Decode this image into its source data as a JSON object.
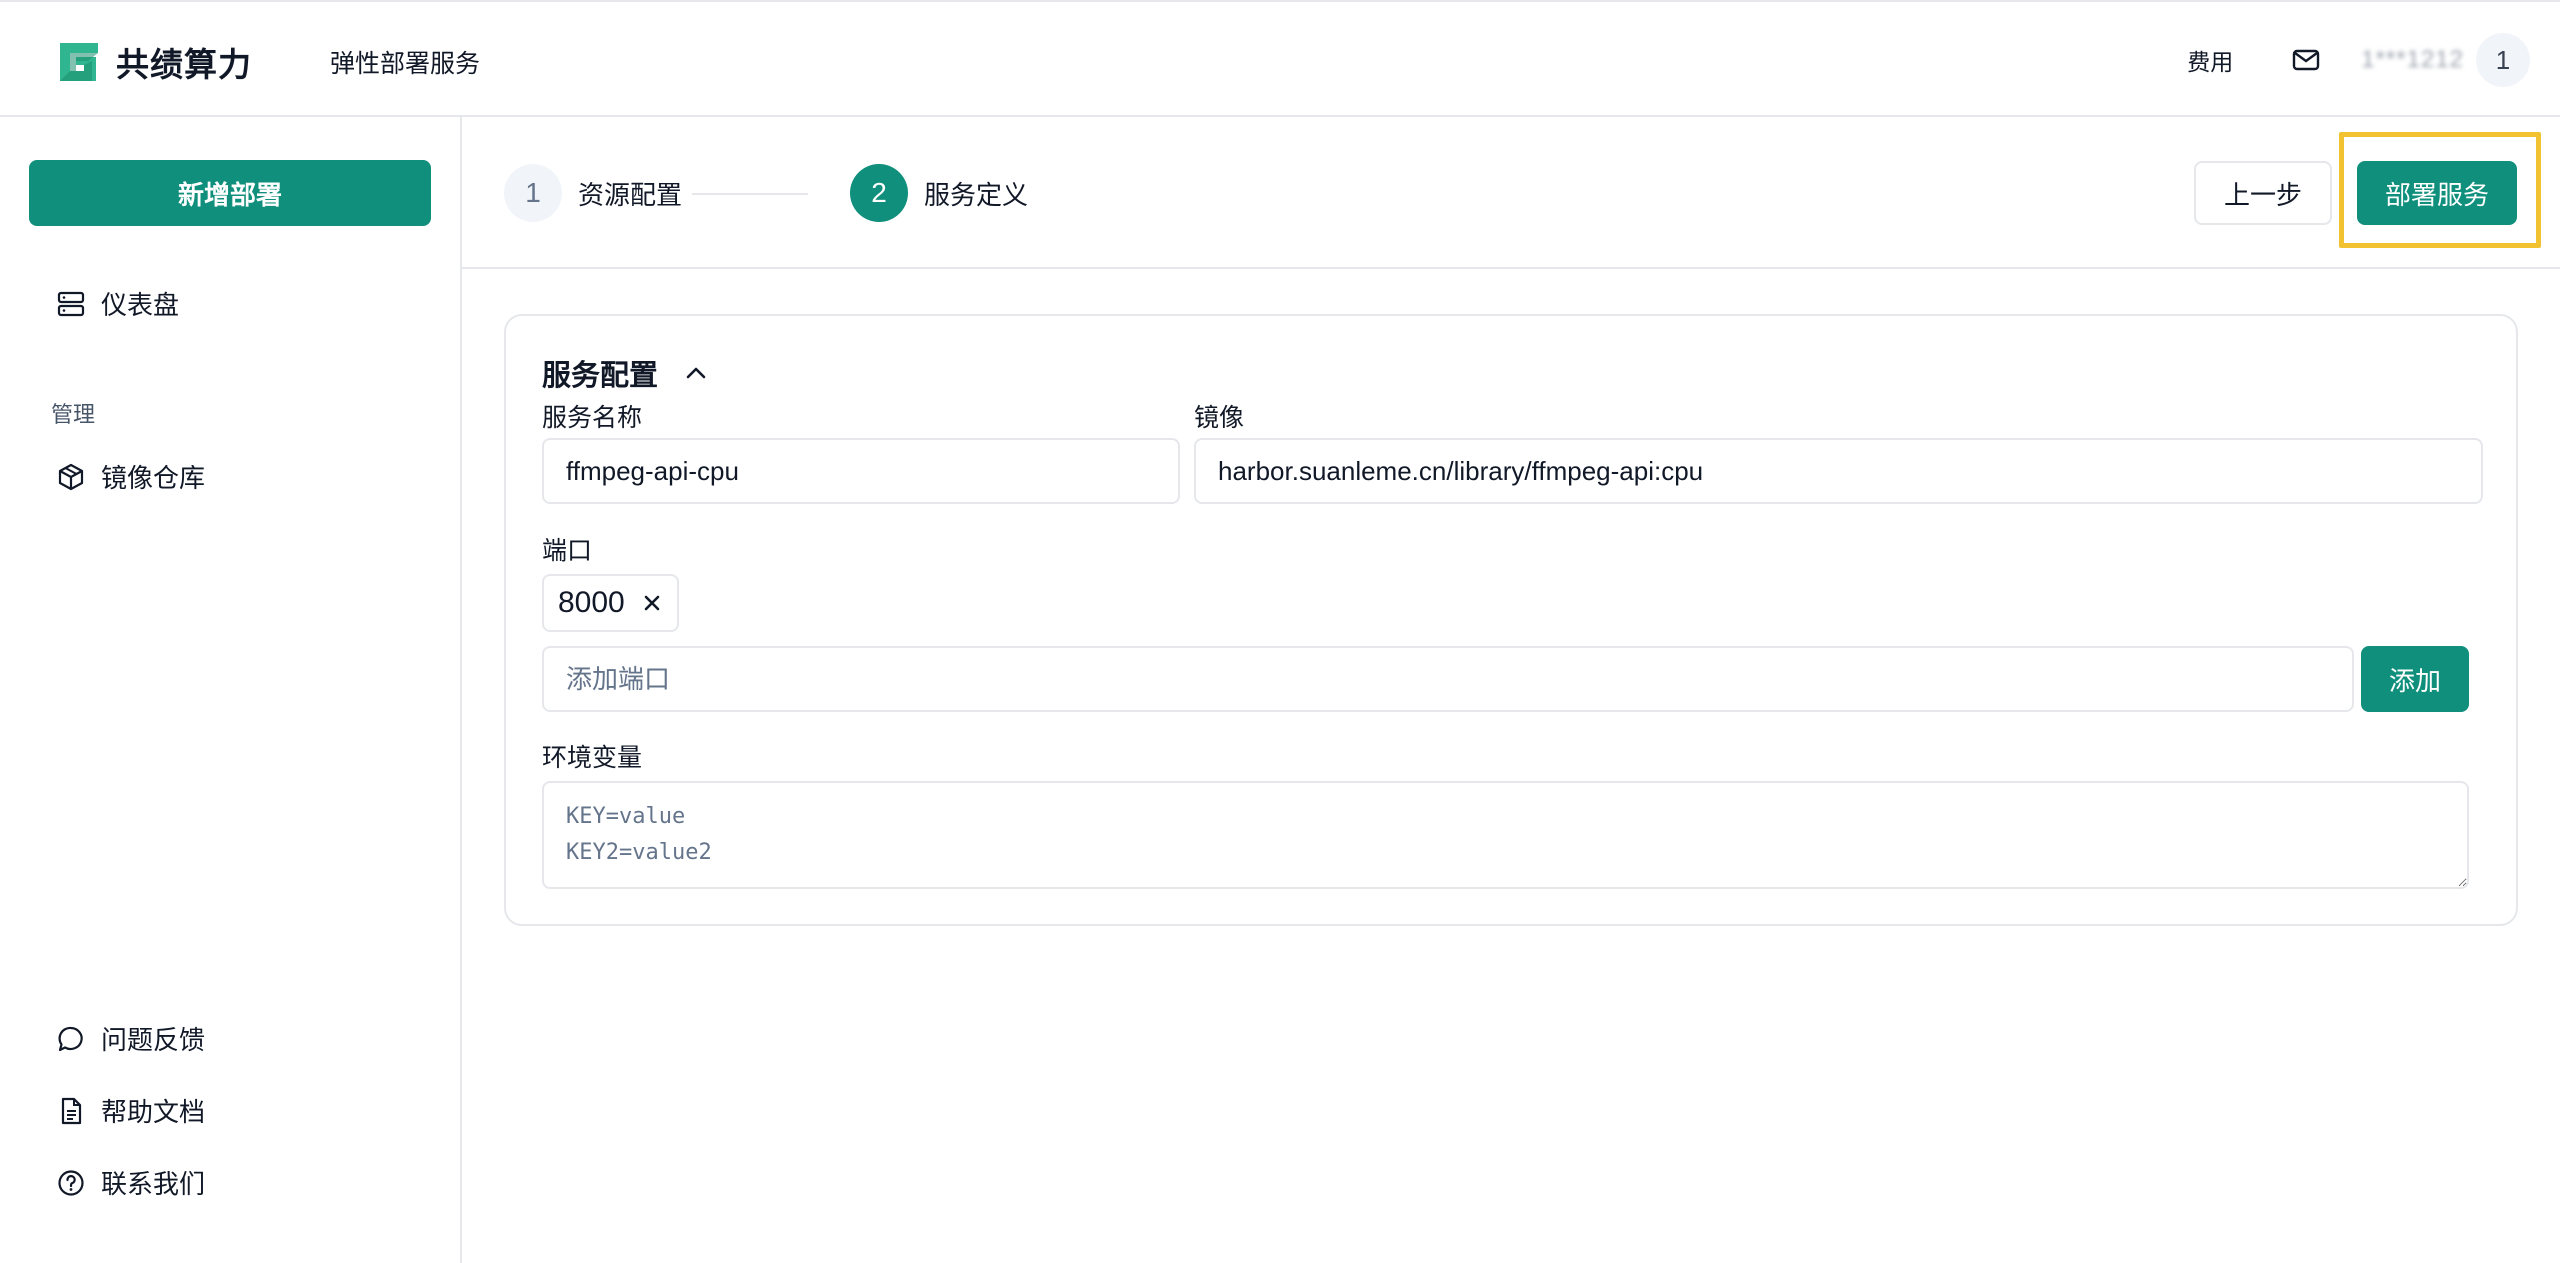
{
  "header": {
    "brand": "共绩算力",
    "product": "弹性部署服务",
    "fee_link": "费用",
    "user_id": "1***1212",
    "avatar_initial": "1"
  },
  "sidebar": {
    "new_deploy": "新增部署",
    "dashboard": "仪表盘",
    "section_manage": "管理",
    "image_repo": "镜像仓库",
    "feedback": "问题反馈",
    "help_docs": "帮助文档",
    "contact": "联系我们"
  },
  "steps": [
    {
      "number": "1",
      "label": "资源配置"
    },
    {
      "number": "2",
      "label": "服务定义"
    }
  ],
  "actions": {
    "prev": "上一步",
    "deploy": "部署服务"
  },
  "service_config": {
    "title": "服务配置",
    "name_label": "服务名称",
    "name_value": "ffmpeg-api-cpu",
    "image_label": "镜像",
    "image_value": "harbor.suanleme.cn/library/ffmpeg-api:cpu",
    "port_label": "端口",
    "ports": [
      "8000"
    ],
    "port_placeholder": "添加端口",
    "add_button": "添加",
    "env_label": "环境变量",
    "env_placeholder": "KEY=value\nKEY2=value2"
  },
  "colors": {
    "brand": "#0f8f7c",
    "highlight": "#f2c230"
  }
}
